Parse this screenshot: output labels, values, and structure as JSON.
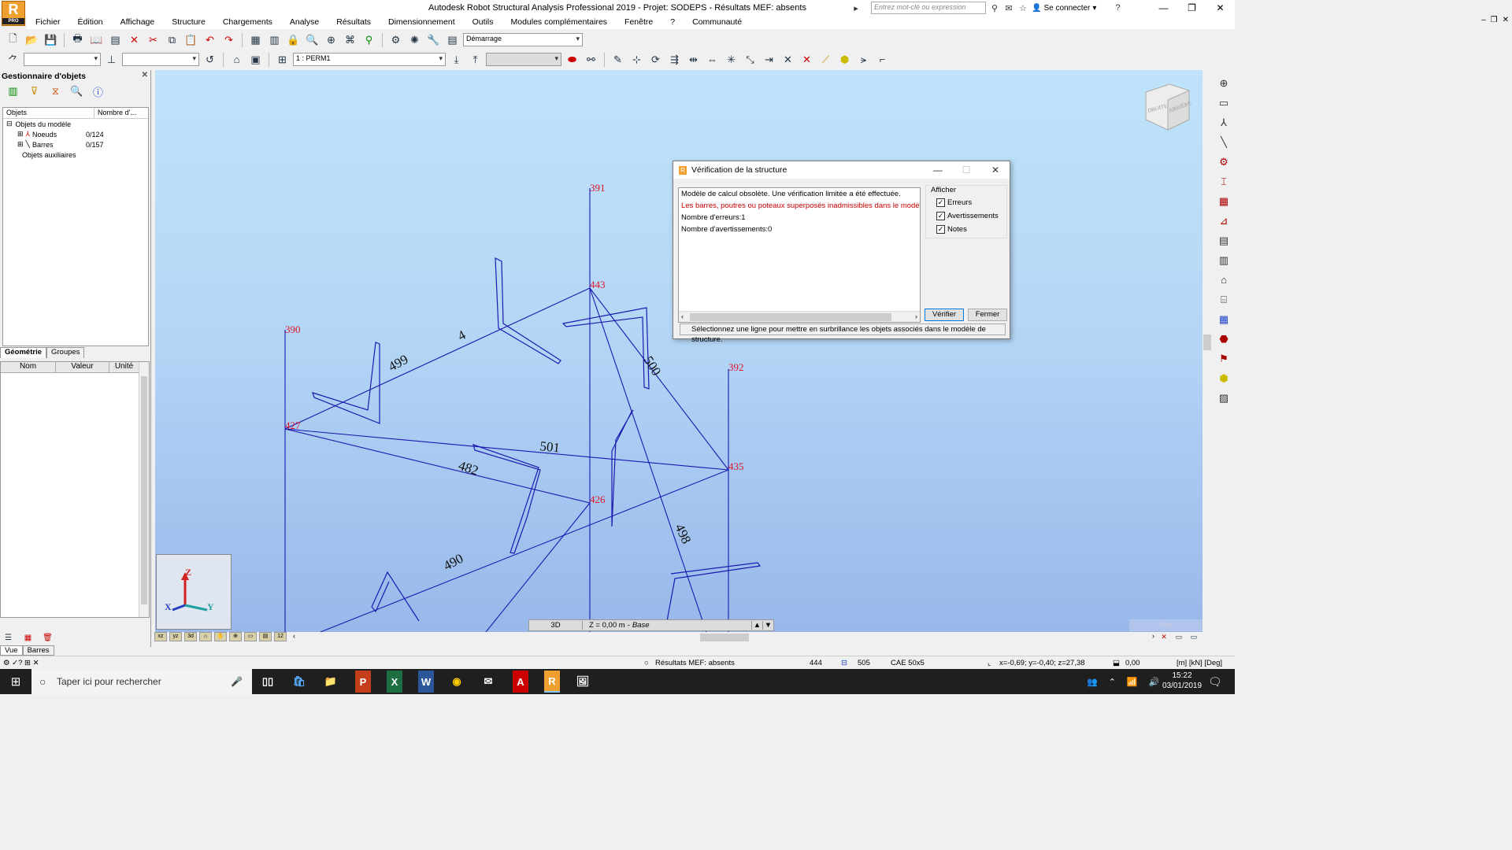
{
  "app": {
    "title": "Autodesk Robot Structural Analysis Professional 2019 - Projet: SODEPS - Résultats MEF: absents",
    "logo_letter": "R",
    "logo_sub": "PRO",
    "search_placeholder": "Entrez mot-clé ou expression",
    "login_label": "Se connecter"
  },
  "menu": [
    "Fichier",
    "Édition",
    "Affichage",
    "Structure",
    "Chargements",
    "Analyse",
    "Résultats",
    "Dimensionnement",
    "Outils",
    "Modules complémentaires",
    "Fenêtre",
    "?",
    "Communauté"
  ],
  "toolbar": {
    "layout_combo": "Démarrage",
    "case_combo": "1 : PERM1"
  },
  "object_manager": {
    "title": "Gestionnaire d'objets",
    "col_objects": "Objets",
    "col_count": "Nombre d'...",
    "tree": [
      {
        "label": "Objets du modèle",
        "count": ""
      },
      {
        "label": "Noeuds",
        "count": "0/124"
      },
      {
        "label": "Barres",
        "count": "0/157"
      },
      {
        "label": "Objets auxiliaires",
        "count": ""
      }
    ],
    "tabs": [
      "Géométrie",
      "Groupes"
    ],
    "props_headers": [
      "Nom",
      "Valeur",
      "Unité"
    ]
  },
  "viewport": {
    "nodes": [
      {
        "id": "391"
      },
      {
        "id": "443"
      },
      {
        "id": "390"
      },
      {
        "id": "392"
      },
      {
        "id": "427"
      },
      {
        "id": "435"
      },
      {
        "id": "426"
      }
    ],
    "bars": [
      {
        "id": "4"
      },
      {
        "id": "499"
      },
      {
        "id": "500"
      },
      {
        "id": "501"
      },
      {
        "id": "482"
      },
      {
        "id": "498"
      },
      {
        "id": "490"
      }
    ],
    "view_cube_labels": [
      "DROITE",
      "ARRIÈRE"
    ],
    "axis_labels": {
      "z": "Z",
      "x": "X",
      "y": "Y"
    },
    "status_mode": "3D",
    "status_level": "Z = 0,00 m",
    "status_level_name": "Base",
    "vue_label": "Vue"
  },
  "dialog": {
    "title": "Vérification de la structure",
    "messages": [
      {
        "text": "Modèle de calcul obsolète. Une vérification limitée a été effectuée.",
        "color": "#000000"
      },
      {
        "text": "Les barres, poutres ou poteaux superposés inadmissibles dans le modèle de c",
        "color": "#c00000"
      },
      {
        "text": "Nombre d'erreurs:1",
        "color": "#000000"
      },
      {
        "text": "Nombre d'avertissements:0",
        "color": "#000000"
      }
    ],
    "afficher_label": "Afficher",
    "checkboxes": [
      {
        "label": "Erreurs",
        "checked": true
      },
      {
        "label": "Avertissements",
        "checked": true
      },
      {
        "label": "Notes",
        "checked": true
      }
    ],
    "verify_button": "Vérifier",
    "close_button": "Fermer",
    "status_text": "Sélectionnez une ligne pour mettre en surbrillance les objets associés dans le modèle de structure."
  },
  "bottom_tabs": [
    "Vue",
    "Barres"
  ],
  "statusbar": {
    "results": "Résultats MEF: absents",
    "node_count": "444",
    "bar_count": "505",
    "section": "CAE 50x5",
    "coords": "x=-0,69; y=-0,40; z=27,38",
    "angle": "0,00",
    "units": "[m] [kN] [Deg]"
  },
  "taskbar": {
    "search_placeholder": "Taper ici pour rechercher",
    "time": "15:22",
    "date": "03/01/2019"
  },
  "colors": {
    "node_label": "#e0142a",
    "bar_line": "#1a1ab0",
    "viewport_top": "#bfe3fa",
    "viewport_bottom": "#98b8ea"
  }
}
